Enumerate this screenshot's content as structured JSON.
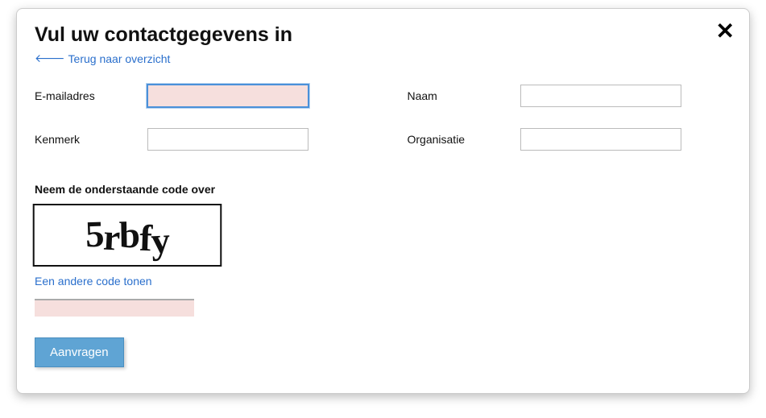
{
  "modal": {
    "title": "Vul uw contactgegevens in",
    "back_link": "Terug naar overzicht",
    "close_label": "✕"
  },
  "form": {
    "email": {
      "label": "E-mailadres",
      "value": ""
    },
    "naam": {
      "label": "Naam",
      "value": ""
    },
    "kenmerk": {
      "label": "Kenmerk",
      "value": ""
    },
    "organisatie": {
      "label": "Organisatie",
      "value": ""
    }
  },
  "captcha": {
    "instruction": "Neem de onderstaande code over",
    "code": "5rbfy",
    "refresh_label": "Een andere code tonen",
    "input_value": ""
  },
  "submit_label": "Aanvragen"
}
